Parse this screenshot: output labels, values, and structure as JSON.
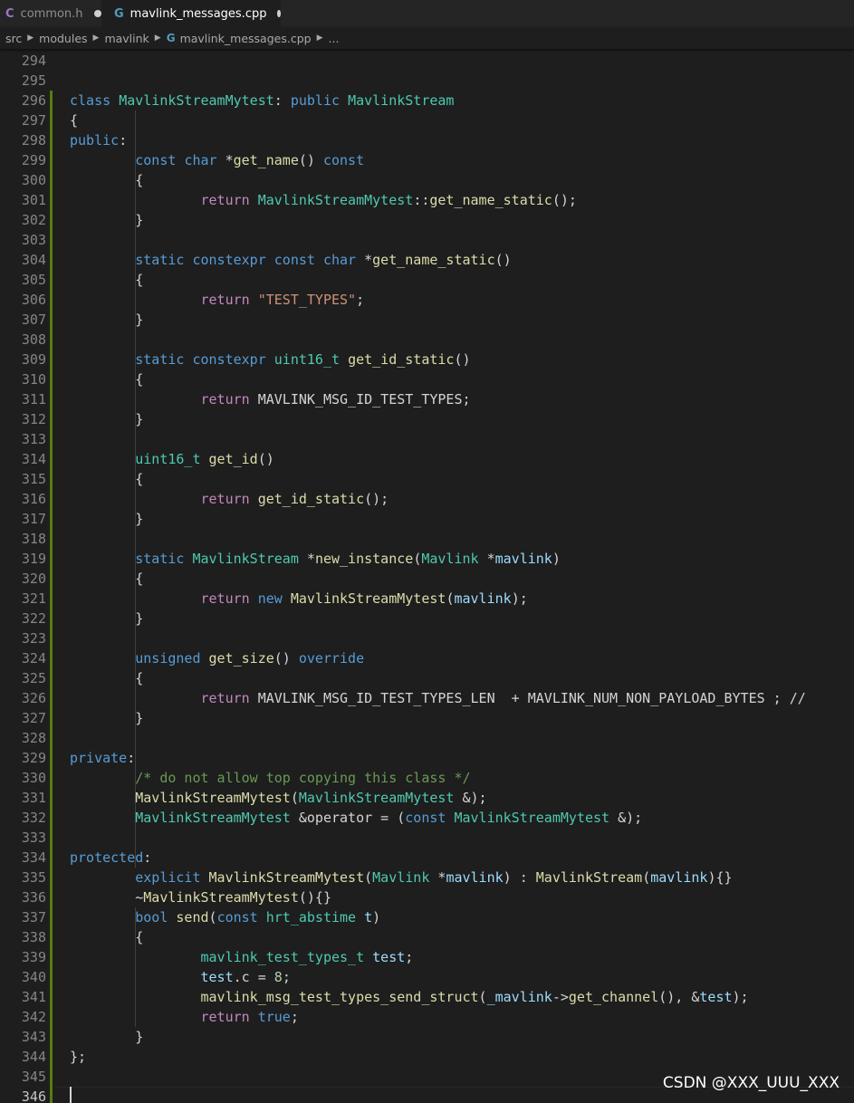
{
  "tabs": [
    {
      "icon": "C",
      "label": "common.h",
      "modified": true,
      "active": false,
      "icon_color": "#a074c4"
    },
    {
      "icon": "G",
      "label": "mavlink_messages.cpp",
      "modified": true,
      "active": true,
      "icon_color": "#519aba"
    }
  ],
  "breadcrumb": [
    "src",
    "modules",
    "mavlink",
    "mavlink_messages.cpp",
    "..."
  ],
  "watermark": "CSDN @XXX_UUU_XXX",
  "colors": {
    "keyword": "#569cd6",
    "type": "#4ec9b0",
    "function": "#dcdcaa",
    "control": "#c586c0",
    "string": "#ce9178",
    "number": "#b5cea8",
    "comment": "#6a9955",
    "variable": "#9cdcfe",
    "git_added": "#587c0c"
  },
  "editor": {
    "lines": [
      {
        "n": "294",
        "text": ""
      },
      {
        "n": "295",
        "text": ""
      },
      {
        "n": "296",
        "text": "class MavlinkStreamMytest: public MavlinkStream"
      },
      {
        "n": "297",
        "text": "{"
      },
      {
        "n": "298",
        "text": "public:"
      },
      {
        "n": "299",
        "text": "        const char *get_name() const"
      },
      {
        "n": "300",
        "text": "        {"
      },
      {
        "n": "301",
        "text": "                return MavlinkStreamMytest::get_name_static();"
      },
      {
        "n": "302",
        "text": "        }"
      },
      {
        "n": "303",
        "text": ""
      },
      {
        "n": "304",
        "text": "        static constexpr const char *get_name_static()"
      },
      {
        "n": "305",
        "text": "        {"
      },
      {
        "n": "306",
        "text": "                return \"TEST_TYPES\";"
      },
      {
        "n": "307",
        "text": "        }"
      },
      {
        "n": "308",
        "text": ""
      },
      {
        "n": "309",
        "text": "        static constexpr uint16_t get_id_static()"
      },
      {
        "n": "310",
        "text": "        {"
      },
      {
        "n": "311",
        "text": "                return MAVLINK_MSG_ID_TEST_TYPES;"
      },
      {
        "n": "312",
        "text": "        }"
      },
      {
        "n": "313",
        "text": ""
      },
      {
        "n": "314",
        "text": "        uint16_t get_id()"
      },
      {
        "n": "315",
        "text": "        {"
      },
      {
        "n": "316",
        "text": "                return get_id_static();"
      },
      {
        "n": "317",
        "text": "        }"
      },
      {
        "n": "318",
        "text": ""
      },
      {
        "n": "319",
        "text": "        static MavlinkStream *new_instance(Mavlink *mavlink)"
      },
      {
        "n": "320",
        "text": "        {"
      },
      {
        "n": "321",
        "text": "                return new MavlinkStreamMytest(mavlink);"
      },
      {
        "n": "322",
        "text": "        }"
      },
      {
        "n": "323",
        "text": ""
      },
      {
        "n": "324",
        "text": "        unsigned get_size() override"
      },
      {
        "n": "325",
        "text": "        {"
      },
      {
        "n": "326",
        "text": "                return MAVLINK_MSG_ID_TEST_TYPES_LEN  + MAVLINK_NUM_NON_PAYLOAD_BYTES ; //"
      },
      {
        "n": "327",
        "text": "        }"
      },
      {
        "n": "328",
        "text": ""
      },
      {
        "n": "329",
        "text": "private:"
      },
      {
        "n": "330",
        "text": "        /* do not allow top copying this class */"
      },
      {
        "n": "331",
        "text": "        MavlinkStreamMytest(MavlinkStreamMytest &);"
      },
      {
        "n": "332",
        "text": "        MavlinkStreamMytest &operator = (const MavlinkStreamMytest &);"
      },
      {
        "n": "333",
        "text": ""
      },
      {
        "n": "334",
        "text": "protected:"
      },
      {
        "n": "335",
        "text": "        explicit MavlinkStreamMytest(Mavlink *mavlink) : MavlinkStream(mavlink){}"
      },
      {
        "n": "336",
        "text": "        ~MavlinkStreamMytest(){}"
      },
      {
        "n": "337",
        "text": "        bool send(const hrt_abstime t)"
      },
      {
        "n": "338",
        "text": "        {"
      },
      {
        "n": "339",
        "text": "                mavlink_test_types_t test;"
      },
      {
        "n": "340",
        "text": "                test.c = 8;"
      },
      {
        "n": "341",
        "text": "                mavlink_msg_test_types_send_struct(_mavlink->get_channel(), &test);"
      },
      {
        "n": "342",
        "text": "                return true;"
      },
      {
        "n": "343",
        "text": "        }"
      },
      {
        "n": "344",
        "text": "};"
      },
      {
        "n": "345",
        "text": ""
      },
      {
        "n": "346",
        "text": "",
        "current": true
      }
    ]
  }
}
